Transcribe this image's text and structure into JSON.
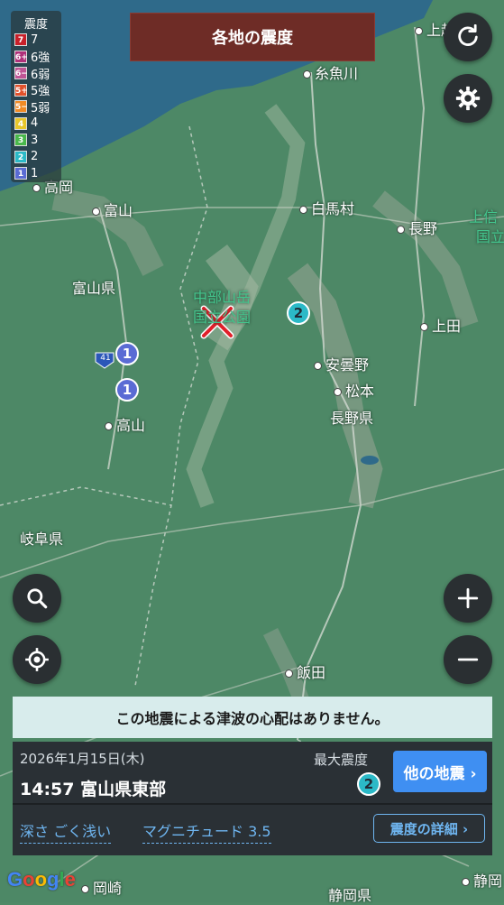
{
  "banner_title": "各地の震度",
  "legend": {
    "title": "震度",
    "items": [
      {
        "code": "7",
        "label": "7",
        "color": "#c8202a"
      },
      {
        "code": "6+",
        "label": "6強",
        "color": "#b0307a"
      },
      {
        "code": "6−",
        "label": "6弱",
        "color": "#c05595"
      },
      {
        "code": "5+",
        "label": "5強",
        "color": "#e2512b"
      },
      {
        "code": "5−",
        "label": "5弱",
        "color": "#f08a24"
      },
      {
        "code": "4",
        "label": "4",
        "color": "#e8c62a"
      },
      {
        "code": "3",
        "label": "3",
        "color": "#49b84b"
      },
      {
        "code": "2",
        "label": "2",
        "color": "#2bb9c7"
      },
      {
        "code": "1",
        "label": "1",
        "color": "#5a6bd4"
      }
    ]
  },
  "map_labels": {
    "joetsu": "上越",
    "itoigawa": "糸魚川",
    "takaoka": "高岡",
    "toyama": "富山",
    "hakuba": "白馬村",
    "nagano": "長野",
    "shinetsu": "上信",
    "kokuritsu": "国立",
    "toyama_ken": "富山県",
    "park1": "中部山岳",
    "park2": "国立公園",
    "ueda": "上田",
    "azumino": "安曇野",
    "matsumoto": "松本",
    "nagano_ken": "長野県",
    "takayama": "高山",
    "gifu_ken": "岐阜県",
    "iida": "飯田",
    "okazaki": "岡崎",
    "shizuoka_ken": "静岡県",
    "shizuoka": "静岡",
    "route": "41"
  },
  "markers": [
    {
      "label": "2",
      "intensity": "2"
    },
    {
      "label": "1",
      "intensity": "1"
    },
    {
      "label": "1",
      "intensity": "1"
    }
  ],
  "tsunami_message": "この地震による津波の心配はありません。",
  "quake": {
    "date": "2026年1月15日(木)",
    "time_place": "14:57 富山県東部",
    "max_label": "最大震度",
    "max_value": "2",
    "other_button": "他の地震 ›",
    "depth": "深さ ごく浅い",
    "magnitude": "マグニチュード 3.5",
    "detail_button": "震度の詳細 ›"
  },
  "attribution": "Google",
  "icons": {
    "refresh": "refresh-icon",
    "settings": "gear-icon",
    "search": "search-icon",
    "locate": "locate-icon",
    "zoom_in": "plus-icon",
    "zoom_out": "minus-icon",
    "epicenter": "cross-marker-icon"
  }
}
